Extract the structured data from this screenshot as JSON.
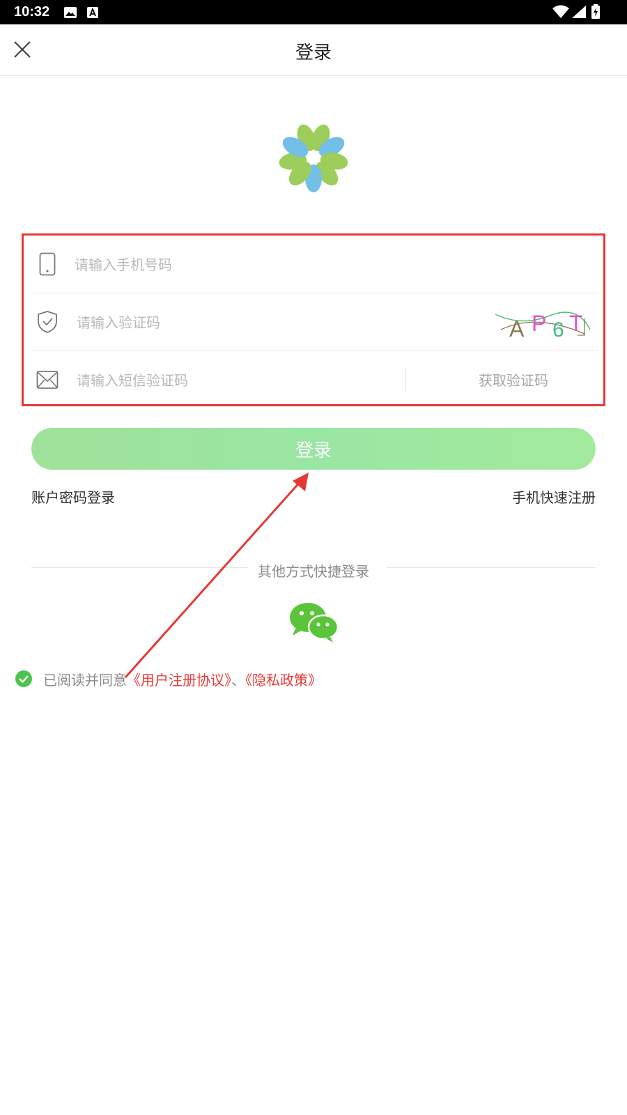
{
  "status_bar": {
    "time": "10:32",
    "icons": [
      "image-icon",
      "a-icon",
      "wifi-icon",
      "signal-icon",
      "battery-icon"
    ]
  },
  "header": {
    "title": "登录",
    "close_icon": "close-icon"
  },
  "form": {
    "phone_placeholder": "请输入手机号码",
    "captcha_placeholder": "请输入验证码",
    "captcha_text": "AP6T",
    "sms_placeholder": "请输入短信验证码",
    "get_code_label": "获取验证码"
  },
  "login_button": "登录",
  "links": {
    "account_login": "账户密码登录",
    "quick_register": "手机快速注册"
  },
  "other_login": {
    "label": "其他方式快捷登录",
    "icon": "wechat-icon"
  },
  "agreement": {
    "prefix": "已阅读并同意",
    "user_agreement": "《用户注册协议》",
    "separator": "、",
    "privacy_policy": "《隐私政策》",
    "checked": true
  },
  "colors": {
    "accent_green": "#9de69f",
    "highlight_red": "#e53935",
    "check_green": "#4cc34c"
  }
}
